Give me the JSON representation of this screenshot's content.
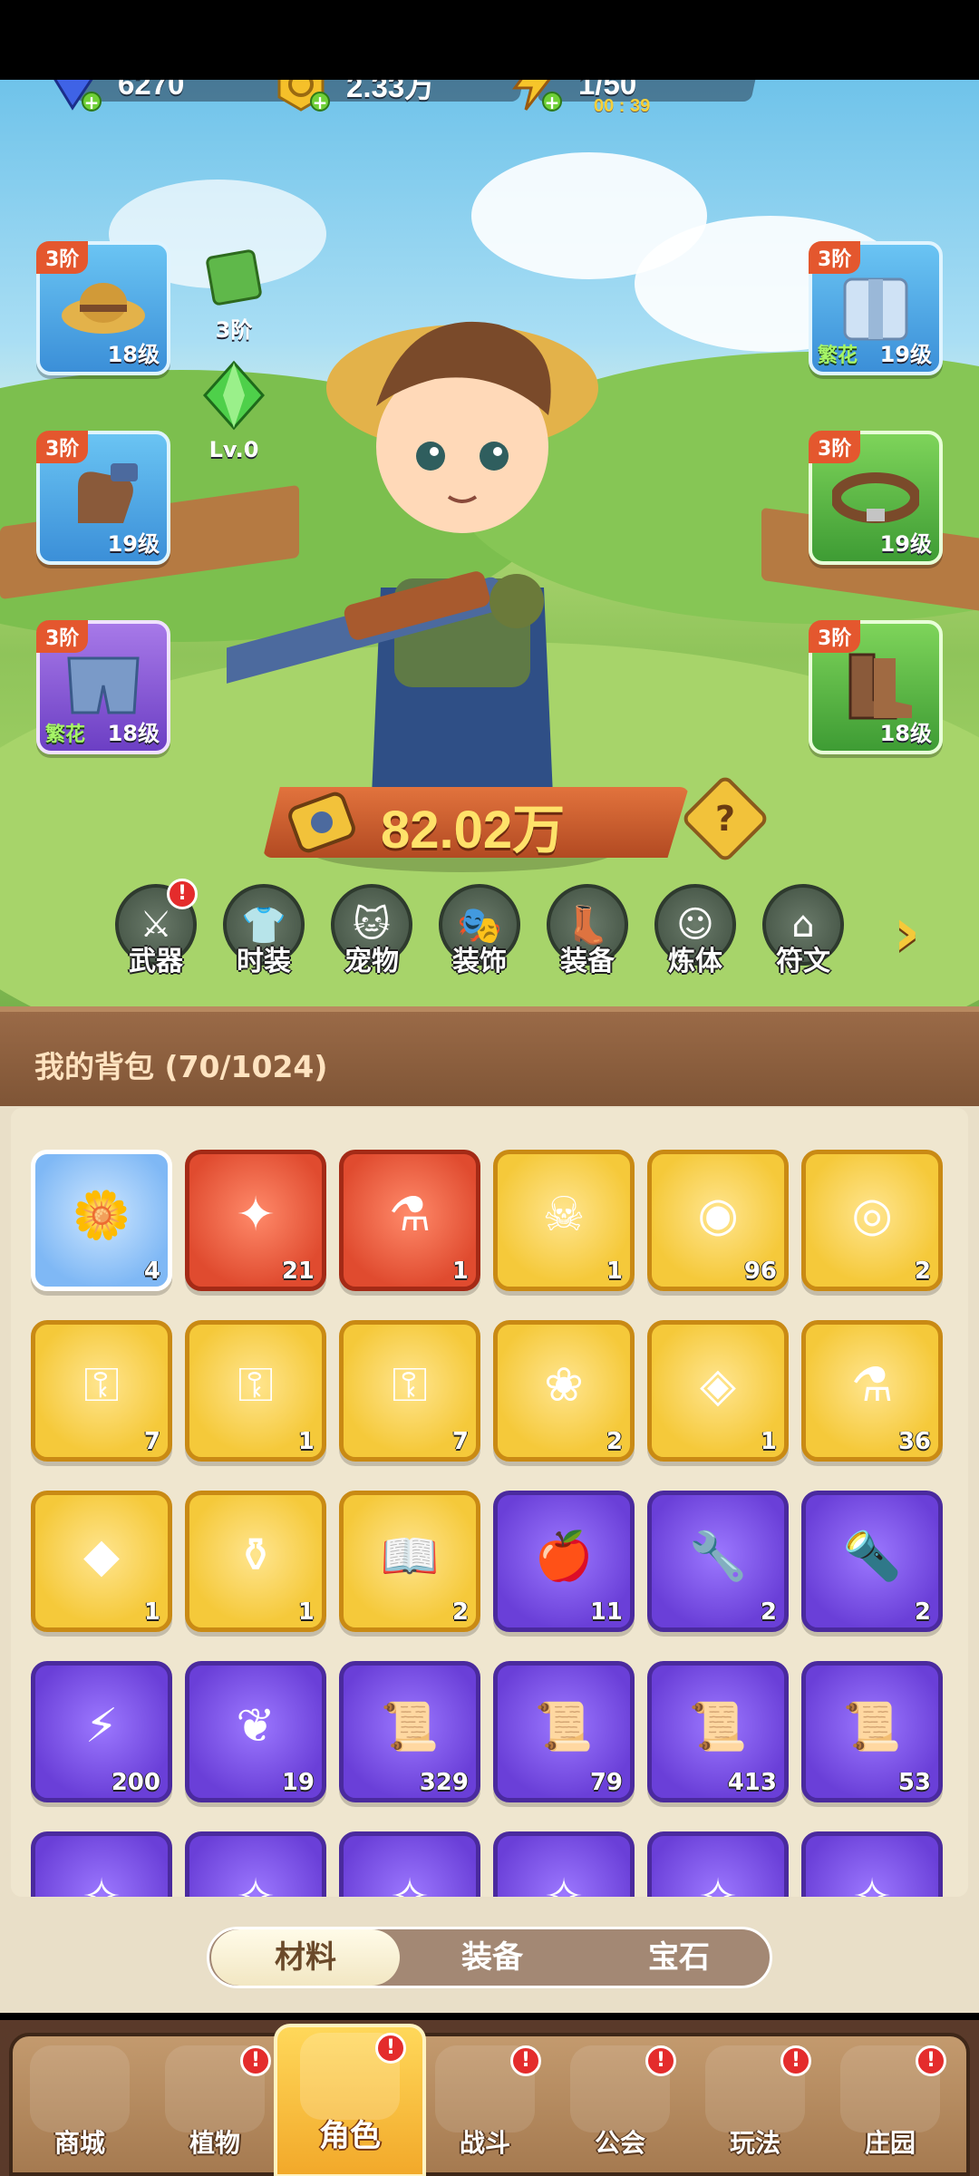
{
  "resources": {
    "gems": "6270",
    "gold": "2.33万",
    "energy": "1/50",
    "energy_timer": "00 : 39"
  },
  "equip_left": [
    {
      "tier": "3阶",
      "level": "18级",
      "item": "straw-hat"
    },
    {
      "tier": "3阶",
      "level": "19级",
      "item": "gloves"
    },
    {
      "tier": "3阶",
      "level": "18级",
      "tag": "繁花",
      "item": "shorts"
    }
  ],
  "equip_right": [
    {
      "tier": "3阶",
      "level": "19级",
      "tag": "繁花",
      "item": "overalls"
    },
    {
      "tier": "3阶",
      "level": "19级",
      "item": "belt"
    },
    {
      "tier": "3阶",
      "level": "18级",
      "item": "boots"
    }
  ],
  "side_items": {
    "scroll_label": "3阶",
    "gem_label": "Lv.0"
  },
  "power": "82.02万",
  "categories": [
    {
      "label": "武器",
      "icon": "weapon-icon",
      "badge": "!"
    },
    {
      "label": "时装",
      "icon": "outfit-icon"
    },
    {
      "label": "宠物",
      "icon": "pet-icon"
    },
    {
      "label": "装饰",
      "icon": "mask-icon"
    },
    {
      "label": "装备",
      "icon": "equipment-icon"
    },
    {
      "label": "炼体",
      "icon": "body-refine-icon"
    },
    {
      "label": "符文",
      "icon": "rune-icon"
    }
  ],
  "bag": {
    "title": "我的背包 (70/1024)",
    "items": [
      {
        "count": "4",
        "rarity": "blue",
        "icon": "duck-flower-icon"
      },
      {
        "count": "21",
        "rarity": "red",
        "icon": "star-crystal-icon"
      },
      {
        "count": "1",
        "rarity": "red",
        "icon": "red-potion-icon"
      },
      {
        "count": "1",
        "rarity": "gold",
        "icon": "skull-scroll-icon"
      },
      {
        "count": "96",
        "rarity": "gold",
        "icon": "duck-coin-icon"
      },
      {
        "count": "2",
        "rarity": "gold",
        "icon": "compass-icon"
      },
      {
        "count": "7",
        "rarity": "gold",
        "icon": "ruby-key-icon"
      },
      {
        "count": "1",
        "rarity": "gold",
        "icon": "purple-key-icon"
      },
      {
        "count": "7",
        "rarity": "gold",
        "icon": "teal-key-icon"
      },
      {
        "count": "2",
        "rarity": "gold",
        "icon": "seed-icon"
      },
      {
        "count": "1",
        "rarity": "gold",
        "icon": "dark-rune-icon"
      },
      {
        "count": "36",
        "rarity": "gold",
        "icon": "orange-potion-icon"
      },
      {
        "count": "1",
        "rarity": "gold",
        "icon": "ore-icon"
      },
      {
        "count": "1",
        "rarity": "gold",
        "icon": "flower-pot-icon"
      },
      {
        "count": "2",
        "rarity": "gold",
        "icon": "book-icon"
      },
      {
        "count": "11",
        "rarity": "purple",
        "icon": "apple-icon"
      },
      {
        "count": "2",
        "rarity": "purple",
        "icon": "wrench-icon"
      },
      {
        "count": "2",
        "rarity": "purple",
        "icon": "flashlight-icon"
      },
      {
        "count": "200",
        "rarity": "purple",
        "icon": "lightning-badge-icon"
      },
      {
        "count": "19",
        "rarity": "purple",
        "icon": "leaf-icon"
      },
      {
        "count": "329",
        "rarity": "purple",
        "icon": "green-scroll-icon"
      },
      {
        "count": "79",
        "rarity": "purple",
        "icon": "purple-scroll-icon"
      },
      {
        "count": "413",
        "rarity": "purple",
        "icon": "blue-scroll-icon"
      },
      {
        "count": "53",
        "rarity": "purple",
        "icon": "red-scroll-icon"
      },
      {
        "count": "",
        "rarity": "purple",
        "icon": "item-icon"
      },
      {
        "count": "",
        "rarity": "purple",
        "icon": "item-icon"
      },
      {
        "count": "",
        "rarity": "purple",
        "icon": "item-icon"
      },
      {
        "count": "",
        "rarity": "purple",
        "icon": "item-icon"
      },
      {
        "count": "",
        "rarity": "purple",
        "icon": "item-icon"
      },
      {
        "count": "",
        "rarity": "purple",
        "icon": "item-icon"
      }
    ]
  },
  "bag_tabs": [
    "材料",
    "装备",
    "宝石"
  ],
  "bottom_nav": [
    {
      "label": "商城",
      "badge": ""
    },
    {
      "label": "植物",
      "badge": "!"
    },
    {
      "label": "角色",
      "badge": "!",
      "active": true
    },
    {
      "label": "战斗",
      "badge": "!"
    },
    {
      "label": "公会",
      "badge": "!"
    },
    {
      "label": "玩法",
      "badge": "!"
    },
    {
      "label": "庄园",
      "badge": "!"
    }
  ],
  "colors": {
    "gold": "#f5c93a",
    "purple": "#6a3fd8",
    "red": "#e04b2f",
    "blue": "#7fb8f5",
    "accent": "#e4572e"
  }
}
